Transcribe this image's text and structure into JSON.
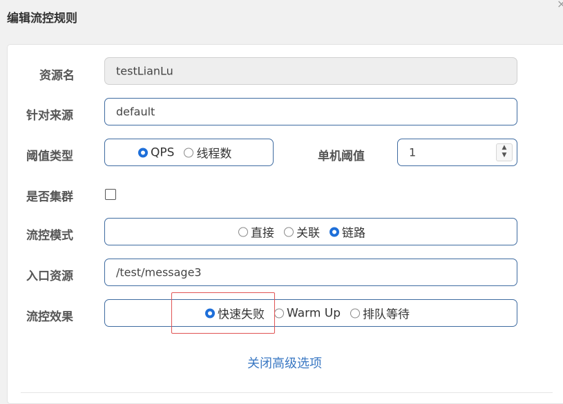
{
  "dialog": {
    "title": "编辑流控规则",
    "close_glyph": "×"
  },
  "form": {
    "resource": {
      "label": "资源名",
      "value": "testLianLu"
    },
    "limit_app": {
      "label": "针对来源",
      "value": "default"
    },
    "grade": {
      "label": "阈值类型",
      "options": [
        "QPS",
        "线程数"
      ],
      "selected": "QPS"
    },
    "count": {
      "label": "单机阈值",
      "value": "1"
    },
    "cluster": {
      "label": "是否集群",
      "checked": false
    },
    "strategy": {
      "label": "流控模式",
      "options": [
        "直接",
        "关联",
        "链路"
      ],
      "selected": "链路"
    },
    "ref_resource": {
      "label": "入口资源",
      "value": "/test/message3"
    },
    "control_behavior": {
      "label": "流控效果",
      "options": [
        "快速失败",
        "Warm Up",
        "排队等待"
      ],
      "selected": "快速失败"
    }
  },
  "advanced_toggle": "关闭高级选项",
  "colors": {
    "accent": "#1e6fd9",
    "border": "#3d6aa0",
    "highlight": "#e05252",
    "link": "#3a78c3"
  }
}
